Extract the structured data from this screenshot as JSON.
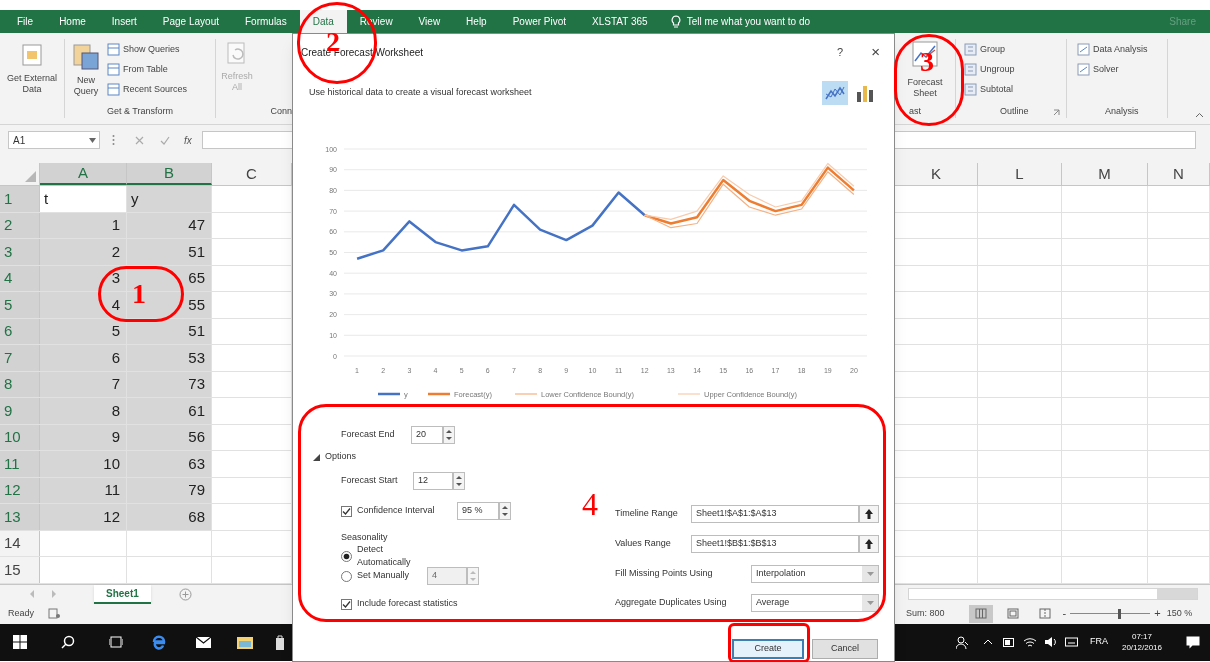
{
  "ribbon_tabs": [
    {
      "label": "File",
      "selected": false
    },
    {
      "label": "Home",
      "selected": false
    },
    {
      "label": "Insert",
      "selected": false
    },
    {
      "label": "Page Layout",
      "selected": false
    },
    {
      "label": "Formulas",
      "selected": false
    },
    {
      "label": "Data",
      "selected": true
    },
    {
      "label": "Review",
      "selected": false
    },
    {
      "label": "View",
      "selected": false
    },
    {
      "label": "Help",
      "selected": false
    },
    {
      "label": "Power Pivot",
      "selected": false
    },
    {
      "label": "XLSTAT 365",
      "selected": false
    }
  ],
  "tell_me": "Tell me what you want to do",
  "share": "Share",
  "ribbon_left": {
    "get_external_data": "Get External Data",
    "new_query": "New Query",
    "small_buttons": [
      "Show Queries",
      "From Table",
      "Recent Sources"
    ],
    "group_label": "Get & Transform",
    "refresh_all": "Refresh All",
    "cut_group_label": "Conn"
  },
  "ribbon_right": {
    "forecast_sheet": "Forecast Sheet",
    "cut_group_label": "ast",
    "outline_buttons": [
      "Group",
      "Ungroup",
      "Subtotal"
    ],
    "outline_label": "Outline",
    "analysis_buttons": [
      "Data Analysis",
      "Solver"
    ],
    "analysis_label": "Analysis"
  },
  "name_box": "A1",
  "function_label": "fx",
  "columns_left": [
    {
      "label": "A",
      "selected": true
    },
    {
      "label": "B",
      "selected": true
    },
    {
      "label": "C",
      "selected": false
    }
  ],
  "columns_right": [
    {
      "label": "K",
      "selected": false
    },
    {
      "label": "L",
      "selected": false
    },
    {
      "label": "M",
      "selected": false
    },
    {
      "label": "N",
      "selected": false
    }
  ],
  "rows": [
    {
      "number": "1",
      "selected": true,
      "kind": "text",
      "cells": [
        {
          "value": "t",
          "active": true
        },
        {
          "value": "y",
          "active": false
        }
      ]
    },
    {
      "number": "2",
      "selected": true,
      "kind": "number",
      "cells": [
        {
          "value": "1",
          "active": false
        },
        {
          "value": "47",
          "active": false
        }
      ]
    },
    {
      "number": "3",
      "selected": true,
      "kind": "number",
      "cells": [
        {
          "value": "2",
          "active": false
        },
        {
          "value": "51",
          "active": false
        }
      ]
    },
    {
      "number": "4",
      "selected": true,
      "kind": "number",
      "cells": [
        {
          "value": "3",
          "active": false
        },
        {
          "value": "65",
          "active": false
        }
      ]
    },
    {
      "number": "5",
      "selected": true,
      "kind": "number",
      "cells": [
        {
          "value": "4",
          "active": false
        },
        {
          "value": "55",
          "active": false
        }
      ]
    },
    {
      "number": "6",
      "selected": true,
      "kind": "number",
      "cells": [
        {
          "value": "5",
          "active": false
        },
        {
          "value": "51",
          "active": false
        }
      ]
    },
    {
      "number": "7",
      "selected": true,
      "kind": "number",
      "cells": [
        {
          "value": "6",
          "active": false
        },
        {
          "value": "53",
          "active": false
        }
      ]
    },
    {
      "number": "8",
      "selected": true,
      "kind": "number",
      "cells": [
        {
          "value": "7",
          "active": false
        },
        {
          "value": "73",
          "active": false
        }
      ]
    },
    {
      "number": "9",
      "selected": true,
      "kind": "number",
      "cells": [
        {
          "value": "8",
          "active": false
        },
        {
          "value": "61",
          "active": false
        }
      ]
    },
    {
      "number": "10",
      "selected": true,
      "kind": "number",
      "cells": [
        {
          "value": "9",
          "active": false
        },
        {
          "value": "56",
          "active": false
        }
      ]
    },
    {
      "number": "11",
      "selected": true,
      "kind": "number",
      "cells": [
        {
          "value": "10",
          "active": false
        },
        {
          "value": "63",
          "active": false
        }
      ]
    },
    {
      "number": "12",
      "selected": true,
      "kind": "number",
      "cells": [
        {
          "value": "11",
          "active": false
        },
        {
          "value": "79",
          "active": false
        }
      ]
    },
    {
      "number": "13",
      "selected": true,
      "kind": "number",
      "cells": [
        {
          "value": "12",
          "active": false
        },
        {
          "value": "68",
          "active": false
        }
      ]
    },
    {
      "number": "14",
      "selected": false,
      "kind": "empty"
    },
    {
      "number": "15",
      "selected": false,
      "kind": "empty"
    }
  ],
  "sheet_tabs": [
    {
      "label": "Sheet1",
      "selected": true
    }
  ],
  "status_bar": {
    "ready": "Ready",
    "sum": "Sum: 800",
    "views": [
      {
        "kind": "normal",
        "selected": true
      },
      {
        "kind": "page-layout",
        "selected": false
      },
      {
        "kind": "page-break",
        "selected": false
      }
    ],
    "zoom_out": "-",
    "zoom_slider": {
      "level": 0.62
    },
    "zoom_in": "+",
    "zoom": "150 %"
  },
  "dialog": {
    "title": "Create Forecast Worksheet",
    "help": "?",
    "close": "×",
    "description": "Use historical data to create a visual forecast worksheet",
    "chart_types": [
      {
        "kind": "line",
        "selected": true
      },
      {
        "kind": "column",
        "selected": false
      }
    ],
    "chart_data": {
      "type": "line",
      "x": [
        1,
        2,
        3,
        4,
        5,
        6,
        7,
        8,
        9,
        10,
        11,
        12,
        13,
        14,
        15,
        16,
        17,
        18,
        19,
        20
      ],
      "xlim": [
        0.5,
        20.5
      ],
      "ylim": [
        0,
        100
      ],
      "grid": true,
      "legend": "bottom",
      "yticks": [
        {
          "value": 0,
          "label": "0"
        },
        {
          "value": 10,
          "label": "10"
        },
        {
          "value": 20,
          "label": "20"
        },
        {
          "value": 30,
          "label": "30"
        },
        {
          "value": 40,
          "label": "40"
        },
        {
          "value": 50,
          "label": "50"
        },
        {
          "value": 60,
          "label": "60"
        },
        {
          "value": 70,
          "label": "70"
        },
        {
          "value": 80,
          "label": "80"
        },
        {
          "value": 90,
          "label": "90"
        },
        {
          "value": 100,
          "label": "100"
        }
      ],
      "xticks": [
        {
          "value": 1,
          "label": "1"
        },
        {
          "value": 2,
          "label": "2"
        },
        {
          "value": 3,
          "label": "3"
        },
        {
          "value": 4,
          "label": "4"
        },
        {
          "value": 5,
          "label": "5"
        },
        {
          "value": 6,
          "label": "6"
        },
        {
          "value": 7,
          "label": "7"
        },
        {
          "value": 8,
          "label": "8"
        },
        {
          "value": 9,
          "label": "9"
        },
        {
          "value": 10,
          "label": "10"
        },
        {
          "value": 11,
          "label": "11"
        },
        {
          "value": 12,
          "label": "12"
        },
        {
          "value": 13,
          "label": "13"
        },
        {
          "value": 14,
          "label": "14"
        },
        {
          "value": 15,
          "label": "15"
        },
        {
          "value": 16,
          "label": "16"
        },
        {
          "value": 17,
          "label": "17"
        },
        {
          "value": 18,
          "label": "18"
        },
        {
          "value": 19,
          "label": "19"
        },
        {
          "value": 20,
          "label": "20"
        }
      ],
      "series": [
        {
          "name": "y",
          "color": "#4472c4",
          "values": [
            47,
            51,
            65,
            55,
            51,
            53,
            73,
            61,
            56,
            63,
            79,
            68,
            null,
            null,
            null,
            null,
            null,
            null,
            null,
            null
          ]
        },
        {
          "name": "Forecast(y)",
          "color": "#ed7d31",
          "values": [
            null,
            null,
            null,
            null,
            null,
            null,
            null,
            null,
            null,
            null,
            null,
            68,
            64,
            67,
            85,
            75,
            70,
            73,
            91,
            80
          ]
        },
        {
          "name": "Lower Confidence Bound(y)",
          "color": "#f4b183",
          "values": [
            null,
            null,
            null,
            null,
            null,
            null,
            null,
            null,
            null,
            null,
            null,
            68,
            62,
            64,
            83,
            72,
            68,
            71,
            89,
            78
          ]
        },
        {
          "name": "Upper Confidence Bound(y)",
          "color": "#f8cbad",
          "values": [
            null,
            null,
            null,
            null,
            null,
            null,
            null,
            null,
            null,
            null,
            null,
            68,
            66,
            70,
            87,
            78,
            72,
            75,
            93,
            82
          ]
        }
      ]
    },
    "forecast_end": {
      "label": "Forecast End",
      "value": "20"
    },
    "options": {
      "label": "Options",
      "expanded": true
    },
    "forecast_start": {
      "label": "Forecast Start",
      "value": "12"
    },
    "confidence": {
      "label": "Confidence Interval",
      "checked": true,
      "value": "95 %"
    },
    "seasonality": {
      "label": "Seasonality",
      "choices": [
        {
          "label": "Detect Automatically",
          "selected": true
        },
        {
          "label": "Set Manually",
          "selected": false,
          "value": "4"
        }
      ]
    },
    "include_statistics": {
      "label": "Include forecast statistics",
      "checked": true
    },
    "ranges": [
      {
        "kind": "range",
        "label": "Timeline Range",
        "value": "Sheet1!$A$1:$A$13"
      },
      {
        "kind": "range",
        "label": "Values Range",
        "value": "Sheet1!$B$1:$B$13"
      },
      {
        "kind": "dropdown",
        "label": "Fill Missing Points Using",
        "value": "Interpolation"
      },
      {
        "kind": "dropdown",
        "label": "Aggregate Duplicates Using",
        "value": "Average"
      }
    ],
    "buttons": [
      {
        "label": "Create",
        "default": true
      },
      {
        "label": "Cancel",
        "default": false
      }
    ]
  },
  "taskbar": {
    "language": "FRA",
    "time": "07:17",
    "date": "20/12/2016"
  },
  "annotations": [
    {
      "kind": "circle",
      "label": "1"
    },
    {
      "kind": "circle",
      "label": "2"
    },
    {
      "kind": "circle",
      "label": "3"
    },
    {
      "kind": "frame",
      "label": "4"
    },
    {
      "kind": "frame"
    }
  ]
}
